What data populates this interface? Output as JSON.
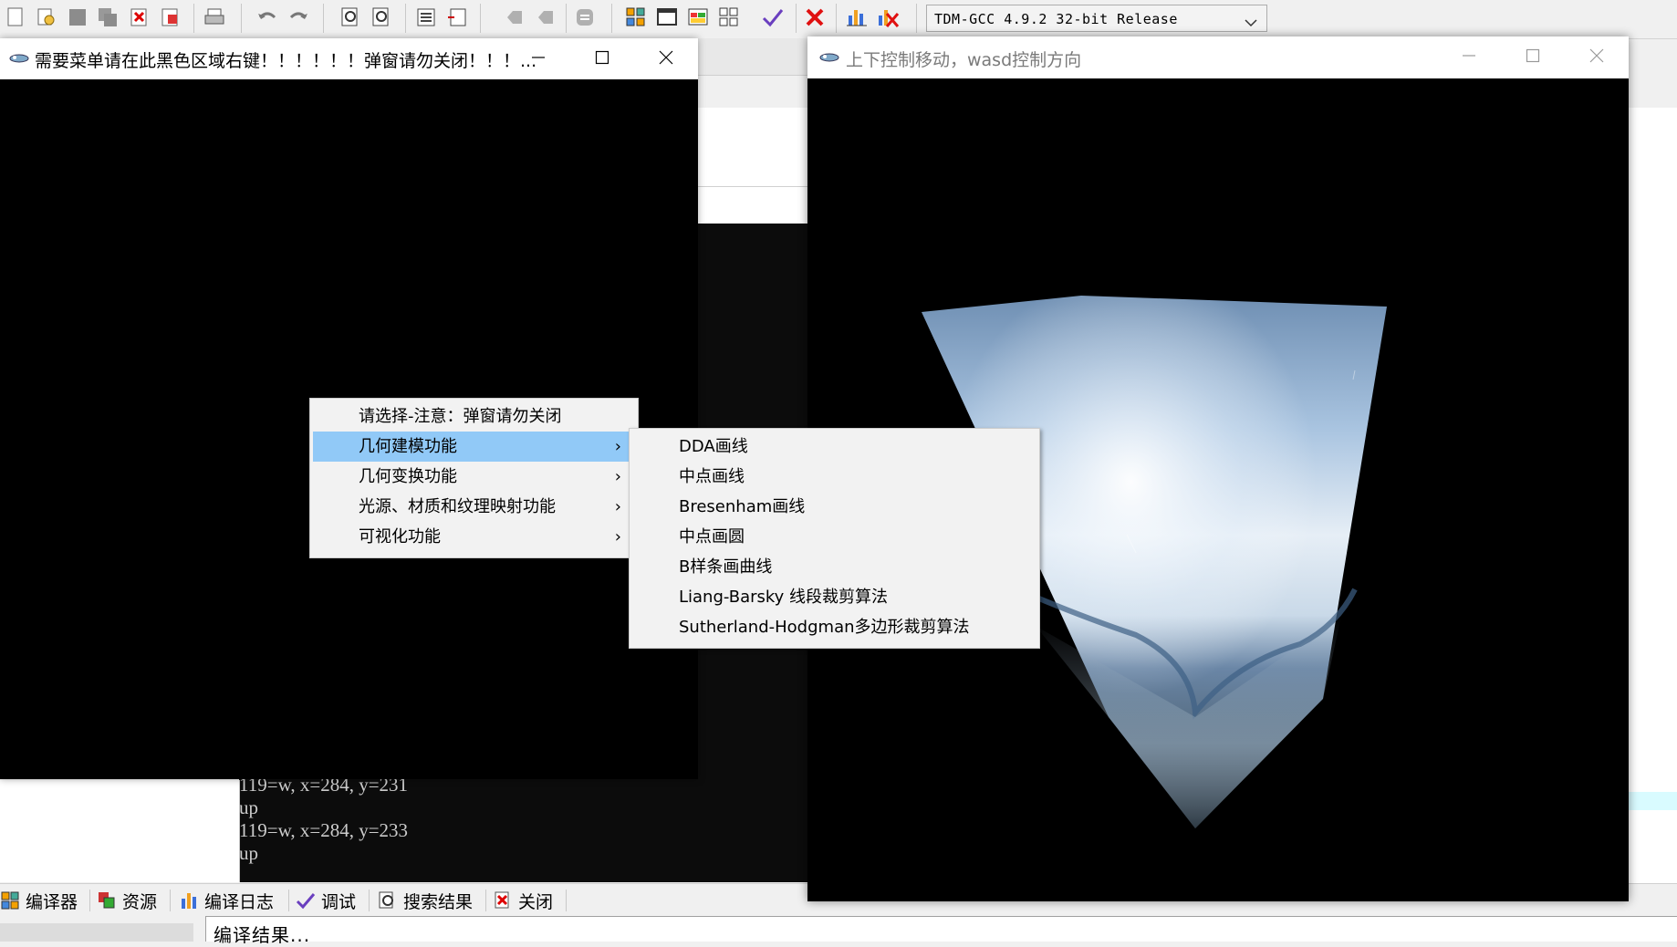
{
  "toolbar": {
    "compiler": "TDM-GCC 4.9.2 32-bit Release"
  },
  "console": {
    "lines": [
      "119=w,  x=284,  y=231",
      "up",
      "119=w,  x=284,  y=233",
      "up"
    ]
  },
  "bottom_tabs": [
    {
      "label": "编译器",
      "icon": "grid-icon"
    },
    {
      "label": "资源",
      "icon": "resources-icon"
    },
    {
      "label": "编译日志",
      "icon": "bar-chart-icon"
    },
    {
      "label": "调试",
      "icon": "check-icon"
    },
    {
      "label": "搜索结果",
      "icon": "search-icon"
    },
    {
      "label": "关闭",
      "icon": "close-doc-icon"
    }
  ],
  "bottom_output": {
    "text": "编译结果..."
  },
  "window_menu": {
    "title": "需要菜单请在此黑色区域右键！！！！！！弹窗请勿关闭！！！..."
  },
  "context_menu": {
    "items": [
      {
        "label": "请选择-注意：弹窗请勿关闭",
        "has_submenu": false,
        "highlighted": false
      },
      {
        "label": "几何建模功能",
        "has_submenu": true,
        "highlighted": true
      },
      {
        "label": "几何变换功能",
        "has_submenu": true,
        "highlighted": false
      },
      {
        "label": "光源、材质和纹理映射功能",
        "has_submenu": true,
        "highlighted": false
      },
      {
        "label": "可视化功能",
        "has_submenu": true,
        "highlighted": false
      }
    ],
    "arrow": "›"
  },
  "submenu": {
    "items": [
      "DDA画线",
      "中点画线",
      "Bresenham画线",
      "中点画圆",
      "B样条画曲线",
      "Liang-Barsky 线段裁剪算法",
      "Sutherland-Hodgman多边形裁剪算法"
    ]
  },
  "window_3d": {
    "title": "上下控制移动，wasd控制方向"
  },
  "colors": {
    "menu_highlight": "#91c9f7",
    "console_bg": "#0c0c0c",
    "window_bg": "#000000"
  }
}
